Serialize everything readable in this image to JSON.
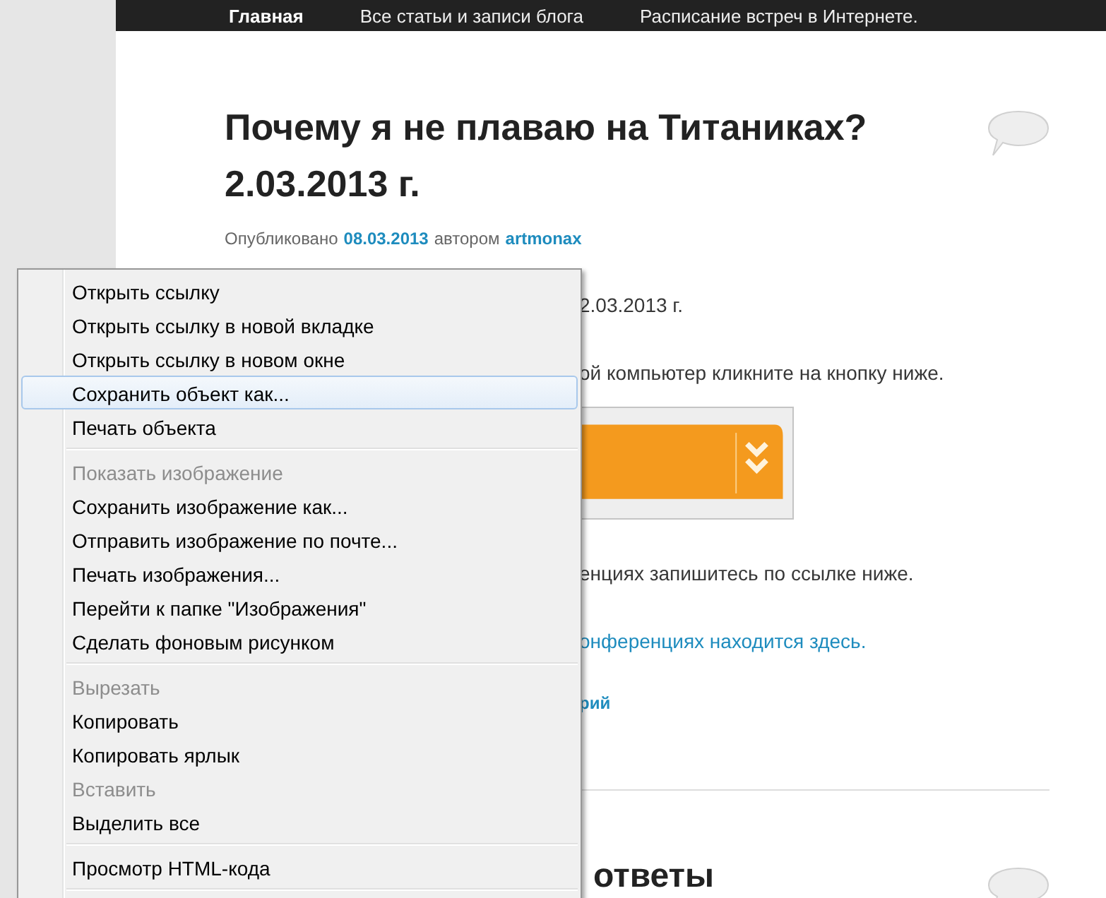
{
  "nav": {
    "items": [
      {
        "label": "Главная",
        "selected": true
      },
      {
        "label": "Все статьи и записи блога",
        "selected": false
      },
      {
        "label": "Расписание встреч в Интернете.",
        "selected": false
      }
    ]
  },
  "post": {
    "title": "Почему я не плаваю на Титаниках? 2.03.2013 г.",
    "meta": [
      {
        "kind": "text",
        "text": "Опубликовано"
      },
      {
        "kind": "link",
        "text": "08.03.2013"
      },
      {
        "kind": "text",
        "text": "автором"
      },
      {
        "kind": "link",
        "text": "artmonax"
      }
    ],
    "body": [
      {
        "kind": "text",
        "text": "2.03.2013 г."
      },
      {
        "kind": "text",
        "text": "ой компьютер кликните на кнопку ниже."
      },
      {
        "kind": "banner"
      },
      {
        "kind": "text",
        "text": "енциях запишитесь по ссылке ниже."
      },
      {
        "kind": "link",
        "text": "онференциях находится здесь."
      },
      {
        "kind": "bold_link",
        "text": "рий"
      }
    ]
  },
  "next_post": {
    "title": "ответы"
  },
  "context_menu": {
    "groups": [
      {
        "items": [
          {
            "label": "Открыть ссылку",
            "disabled": false,
            "selected": false
          },
          {
            "label": "Открыть ссылку в новой вкладке",
            "disabled": false,
            "selected": false
          },
          {
            "label": "Открыть ссылку в новом окне",
            "disabled": false,
            "selected": false
          },
          {
            "label": "Сохранить объект как...",
            "disabled": false,
            "selected": true
          },
          {
            "label": "Печать объекта",
            "disabled": false,
            "selected": false
          }
        ]
      },
      {
        "items": [
          {
            "label": "Показать изображение",
            "disabled": true,
            "selected": false
          },
          {
            "label": "Сохранить изображение как...",
            "disabled": false,
            "selected": false
          },
          {
            "label": "Отправить изображение по почте...",
            "disabled": false,
            "selected": false
          },
          {
            "label": "Печать изображения...",
            "disabled": false,
            "selected": false
          },
          {
            "label": "Перейти к папке \"Изображения\"",
            "disabled": false,
            "selected": false
          },
          {
            "label": "Сделать фоновым рисунком",
            "disabled": false,
            "selected": false
          }
        ]
      },
      {
        "items": [
          {
            "label": "Вырезать",
            "disabled": true,
            "selected": false
          },
          {
            "label": "Копировать",
            "disabled": false,
            "selected": false
          },
          {
            "label": "Копировать ярлык",
            "disabled": false,
            "selected": false
          },
          {
            "label": "Вставить",
            "disabled": true,
            "selected": false
          },
          {
            "label": "Выделить все",
            "disabled": false,
            "selected": false
          }
        ]
      },
      {
        "items": [
          {
            "label": "Просмотр HTML-кода",
            "disabled": false,
            "selected": false
          }
        ]
      }
    ]
  }
}
